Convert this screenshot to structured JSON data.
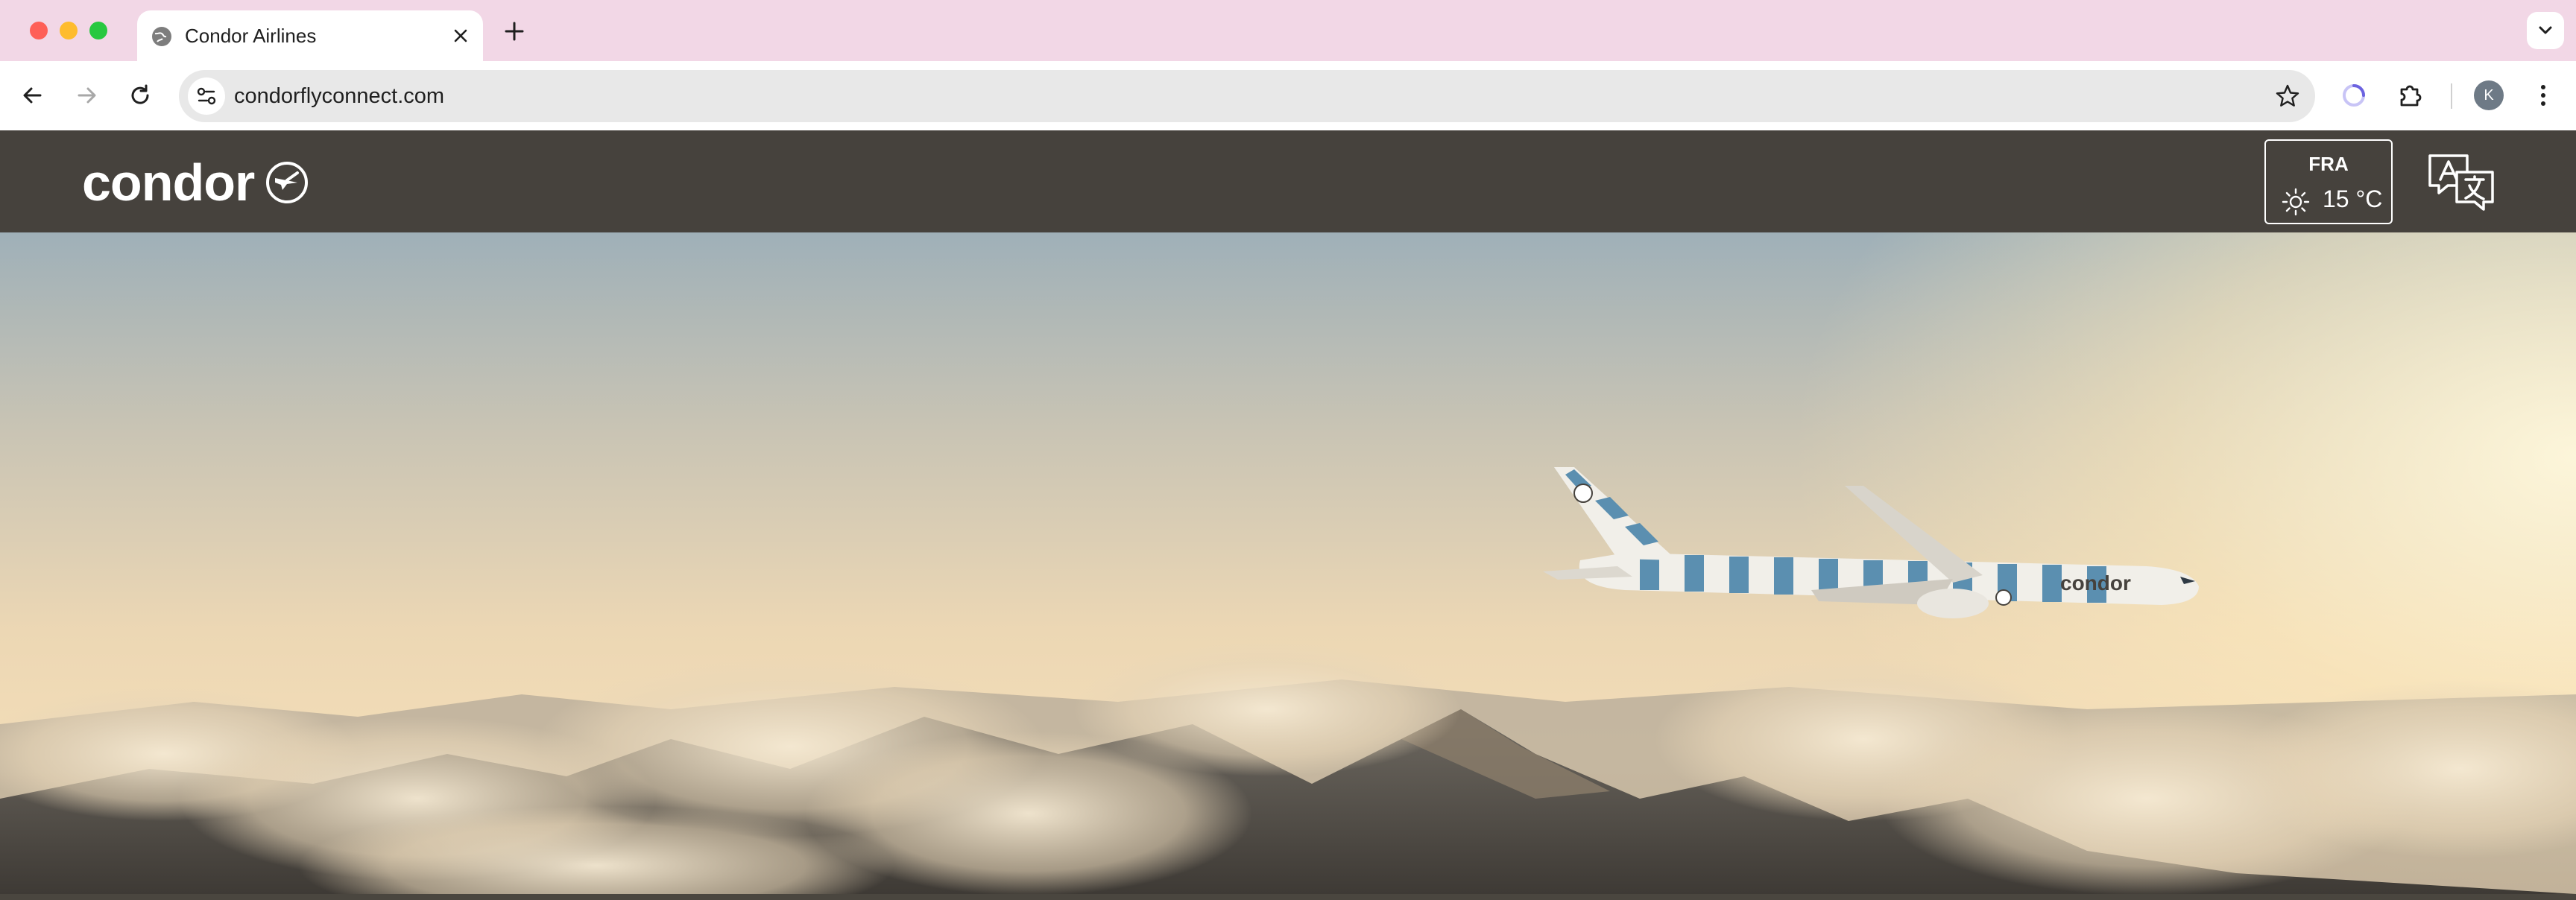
{
  "browser": {
    "tab": {
      "title": "Condor Airlines"
    },
    "address_bar": {
      "url": "condorflyconnect.com"
    },
    "profile": {
      "initial": "K"
    }
  },
  "site": {
    "brand": {
      "name": "condor"
    },
    "weather": {
      "airport_code": "FRA",
      "temperature": "15 °C",
      "icon": "sun-icon"
    },
    "language_icon": "translate-icon"
  },
  "hero": {
    "aircraft_livery_text": "condor"
  },
  "colors": {
    "tab_strip": "#f2d7e6",
    "site_header": "#46423d",
    "livery_blue": "#5b8fb0"
  }
}
